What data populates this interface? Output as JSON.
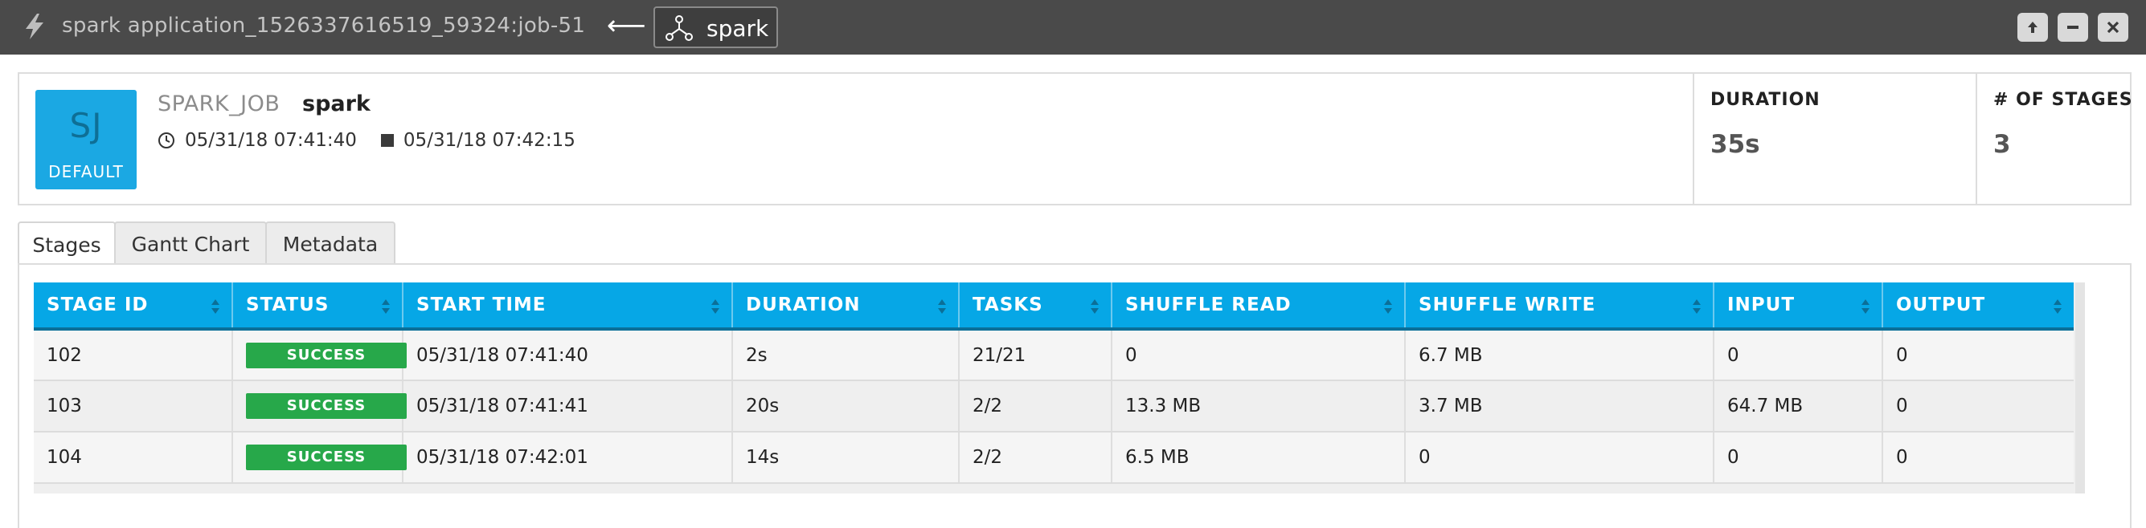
{
  "window": {
    "title": "spark application_1526337616519_59324:job-51",
    "back_arrow": "⟵",
    "parent_label": "spark",
    "icons": {
      "app": "bolt-icon",
      "parent": "spark-dag-icon"
    },
    "controls": [
      "pin-icon",
      "minimize-icon",
      "close-icon"
    ]
  },
  "job": {
    "badge_initials": "SJ",
    "badge_subtitle": "DEFAULT",
    "type": "SPARK_JOB",
    "name": "spark",
    "start_time": "05/31/18 07:41:40",
    "end_time": "05/31/18 07:42:15"
  },
  "metrics": {
    "duration_label": "DURATION",
    "duration_value": "35s",
    "stages_label": "# OF STAGES",
    "stages_value": "3"
  },
  "tabs": [
    {
      "label": "Stages",
      "active": true
    },
    {
      "label": "Gantt Chart",
      "active": false
    },
    {
      "label": "Metadata",
      "active": false
    }
  ],
  "table": {
    "columns": [
      "STAGE ID",
      "STATUS",
      "START TIME",
      "DURATION",
      "TASKS",
      "SHUFFLE READ",
      "SHUFFLE WRITE",
      "INPUT",
      "OUTPUT"
    ],
    "rows": [
      {
        "stage_id": "102",
        "status": "SUCCESS",
        "start_time": "05/31/18 07:41:40",
        "duration": "2s",
        "tasks": "21/21",
        "shuffle_read": "0",
        "shuffle_write": "6.7 MB",
        "input": "0",
        "output": "0"
      },
      {
        "stage_id": "103",
        "status": "SUCCESS",
        "start_time": "05/31/18 07:41:41",
        "duration": "20s",
        "tasks": "2/2",
        "shuffle_read": "13.3 MB",
        "shuffle_write": "3.7 MB",
        "input": "64.7 MB",
        "output": "0"
      },
      {
        "stage_id": "104",
        "status": "SUCCESS",
        "start_time": "05/31/18 07:42:01",
        "duration": "14s",
        "tasks": "2/2",
        "shuffle_read": "6.5 MB",
        "shuffle_write": "0",
        "input": "0",
        "output": "0"
      }
    ]
  },
  "colors": {
    "titlebar": "#4a4a4a",
    "accent": "#06a7e6",
    "badge": "#1ba8e3",
    "success": "#27a84a"
  }
}
